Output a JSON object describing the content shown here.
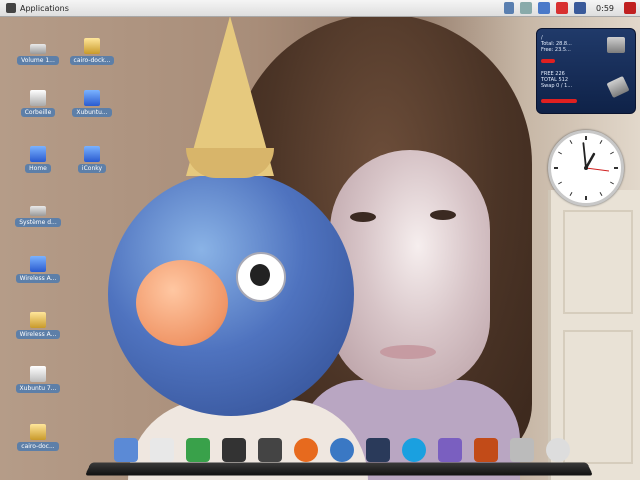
{
  "topbar": {
    "menu_label": "Applications",
    "clock": "0:59"
  },
  "desktop_icons": [
    {
      "label": "Volume 1...",
      "icon": "drive-icon"
    },
    {
      "label": "cairo-dock...",
      "icon": "folder-icon"
    },
    {
      "label": "Corbeille",
      "icon": "trash-icon"
    },
    {
      "label": "Xubuntu...",
      "icon": "folder-icon"
    },
    {
      "label": "Home",
      "icon": "home-folder-icon"
    },
    {
      "label": "iConky",
      "icon": "folder-icon"
    },
    {
      "label": "Système d...",
      "icon": "drive-icon"
    },
    {
      "label": "Wireless A...",
      "icon": "folder-icon"
    },
    {
      "label": "Wireless A...",
      "icon": "folder-icon"
    },
    {
      "label": "Xubuntu 7...",
      "icon": "usb-drive-icon"
    },
    {
      "label": "cairo-doc...",
      "icon": "folder-icon"
    }
  ],
  "sysmon": {
    "lines_top": [
      "/",
      "Total: 28.8...",
      "Free: 23.5..."
    ],
    "lines_bottom": [
      "FREE 226",
      "TOTAL 512",
      "Swap 0 / 1..."
    ],
    "cpu_fraction": 0.15,
    "mem_fraction": 0.4
  },
  "analog_clock": {
    "hour": 0,
    "minute": 59
  },
  "dock": {
    "items": [
      "home-icon",
      "text-editor-icon",
      "graph-icon",
      "penguin-icon",
      "terminal-penguin-icon",
      "firefox-icon",
      "thunderbird-icon",
      "screen-icon",
      "skype-icon",
      "chat-icon",
      "filezilla-icon",
      "calculator-icon",
      "cd-icon"
    ]
  },
  "colors": {
    "icon_label_bg": "#5d7fa8",
    "sysmon_bg": "#203a6a",
    "alert_red": "#e02020"
  }
}
